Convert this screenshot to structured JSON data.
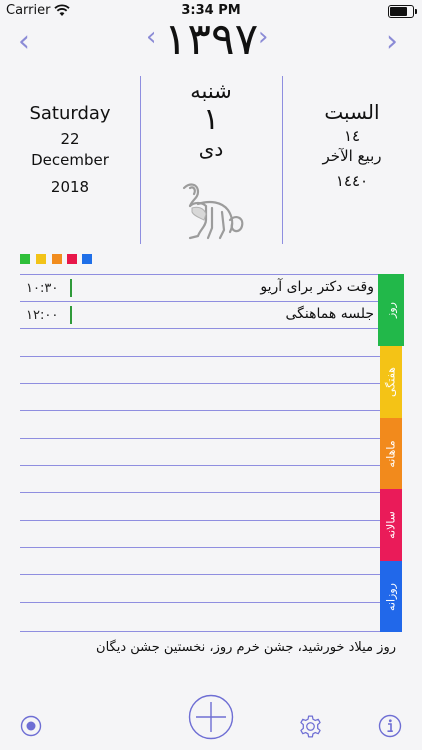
{
  "status_bar": {
    "carrier": "Carrier",
    "time": "3:34 PM",
    "battery_level": 0.85
  },
  "header": {
    "year": "۱۳۹۷"
  },
  "dates": {
    "gregorian": {
      "weekday": "Saturday",
      "day": "22",
      "month": "December",
      "year": "2018"
    },
    "persian": {
      "weekday": "شنبه",
      "day": "۱",
      "month": "دی"
    },
    "hijri": {
      "weekday": "السبت",
      "day": "١٤",
      "month": "ربيع الآخر",
      "year": "١٤٤٠"
    }
  },
  "colors": {
    "accent": "#8b8bd6",
    "swatches": [
      "#2fbf3a",
      "#f2c318",
      "#f18c1e",
      "#e8174a",
      "#1f6fe8"
    ],
    "event_bar": "#2f9a3a"
  },
  "events": [
    {
      "title": "وقت دکتر برای آریو",
      "time": "۱۰:۳۰"
    },
    {
      "title": "جلسه هماهنگی",
      "time": "۱۲:۰۰"
    }
  ],
  "tabs": [
    {
      "label": "روز",
      "color": "#22b84a",
      "active": true
    },
    {
      "label": "هفتگی",
      "color": "#f4c316",
      "active": false
    },
    {
      "label": "ماهانه",
      "color": "#f28a1c",
      "active": false
    },
    {
      "label": "سالانه",
      "color": "#ea1b59",
      "active": false
    },
    {
      "label": "روزانه",
      "color": "#2168ea",
      "active": false
    }
  ],
  "occasion": "روز میلاد خورشید، جشن خرم روز، نخستین جشن دیگان",
  "icons": {
    "left": "today-icon",
    "center": "add-icon",
    "settings": "gear-icon",
    "info": "info-icon"
  }
}
